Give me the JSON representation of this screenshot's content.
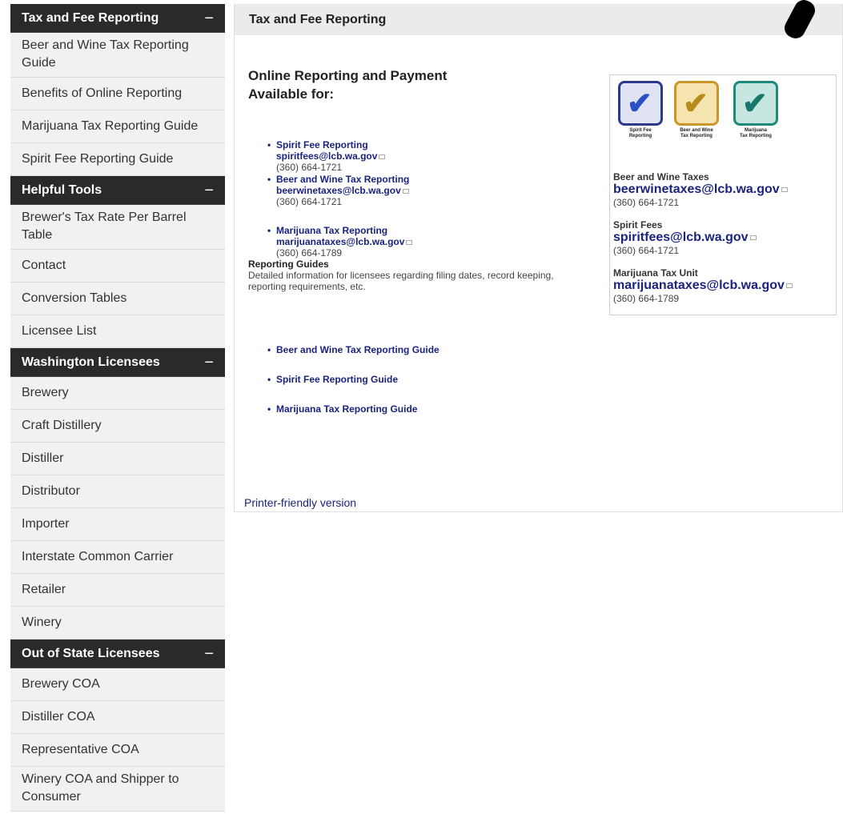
{
  "sidebar": {
    "sections": [
      {
        "title": "Tax and Fee Reporting",
        "toggle": "−",
        "items": [
          "Beer and Wine Tax Reporting Guide",
          "Benefits of Online Reporting",
          "Marijuana Tax Reporting Guide",
          "Spirit Fee Reporting Guide"
        ]
      },
      {
        "title": "Helpful Tools",
        "toggle": "−",
        "items": [
          "Brewer's Tax Rate Per Barrel Table",
          "Contact",
          "Conversion Tables",
          "Licensee List"
        ]
      },
      {
        "title": "Washington Licensees",
        "toggle": "−",
        "items": [
          "Brewery",
          "Craft Distillery",
          "Distiller",
          "Distributor",
          "Importer",
          "Interstate Common Carrier",
          "Retailer",
          "Winery"
        ]
      },
      {
        "title": "Out of State Licensees",
        "toggle": "−",
        "items": [
          "Brewery COA",
          "Distiller COA",
          "Representative COA",
          "Winery COA and Shipper to Consumer"
        ]
      }
    ]
  },
  "main": {
    "title": "Tax and Fee Reporting",
    "heading_line1": "Online Reporting and Payment",
    "heading_line2": "Available for:",
    "online_items": [
      {
        "label": "Spirit Fee Reporting",
        "email": "spiritfees@lcb.wa.gov",
        "phone": "(360) 664-1721"
      },
      {
        "label": "Beer and Wine Tax Reporting",
        "email": "beerwinetaxes@lcb.wa.gov",
        "phone": "(360) 664-1721"
      },
      {
        "label": "Marijuana Tax Reporting",
        "email": "marijuanataxes@lcb.wa.gov",
        "phone": "(360) 664-1789"
      }
    ],
    "reporting_guides_title": "Reporting Guides",
    "reporting_guides_desc": "Detailed information for licensees regarding filing dates, record keeping, reporting requirements, etc.",
    "guide_links": [
      "Beer and Wine Tax Reporting Guide",
      "Spirit Fee Reporting Guide",
      "Marijuana Tax Reporting Guide"
    ],
    "printer_friendly": "Printer-friendly version"
  },
  "contact_box": {
    "badges": [
      {
        "caption_line1": "Spirit Fee",
        "caption_line2": "Reporting",
        "color": "#2d3a8c",
        "check_color": "#2a4fc9",
        "icon": "checkmark-icon"
      },
      {
        "caption_line1": "Beer and Wine",
        "caption_line2": "Tax Reporting",
        "color": "#c9962a",
        "check_color": "#b68a1c",
        "icon": "checkmark-icon"
      },
      {
        "caption_line1": "Marijuana",
        "caption_line2": "Tax Reporting",
        "color": "#1e8a7a",
        "check_color": "#17786b",
        "icon": "checkmark-icon"
      }
    ],
    "contacts": [
      {
        "title": "Beer and Wine Taxes",
        "email": "beerwinetaxes@lcb.wa.gov",
        "phone": "(360) 664-1721"
      },
      {
        "title": "Spirit Fees",
        "email": "spiritfees@lcb.wa.gov",
        "phone": "(360) 664-1721"
      },
      {
        "title": "Marijuana Tax Unit",
        "email": "marijuanataxes@lcb.wa.gov",
        "phone": "(360) 664-1789"
      }
    ]
  }
}
